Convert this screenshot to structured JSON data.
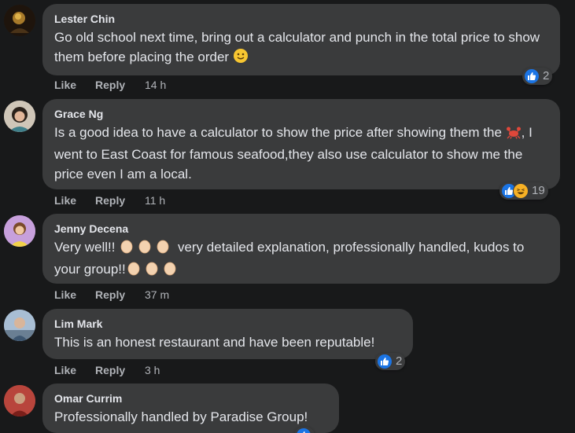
{
  "comments": [
    {
      "author": "Lester Chin",
      "text": "Go old school next time, bring out a calculator and punch in the total price to show them before placing the order",
      "emoji": "slightly-smiling-face",
      "like_label": "Like",
      "reply_label": "Reply",
      "time": "14 h",
      "reaction_count": "2",
      "reactions": [
        "like"
      ]
    },
    {
      "author": "Grace Ng",
      "text_part1": "Is a good idea to have a calculator to show the price after showing them the",
      "emoji": "crab",
      "text_part2": ", I went to East Coast for famous seafood,they also use calculator to show me the price even I am a local.",
      "like_label": "Like",
      "reply_label": "Reply",
      "time": "11 h",
      "reaction_count": "19",
      "reactions": [
        "like",
        "haha"
      ]
    },
    {
      "author": "Jenny Decena",
      "text_part1": "Very well!!",
      "text_part2": " very detailed explanation, professionally handled, kudos to your group!!",
      "emoji": "clapping-hands",
      "like_label": "Like",
      "reply_label": "Reply",
      "time": "37 m",
      "reactions": []
    },
    {
      "author": "Lim Mark",
      "text": "This is an honest restaurant and have been reputable!",
      "like_label": "Like",
      "reply_label": "Reply",
      "time": "3 h",
      "reaction_count": "2",
      "reactions": [
        "like"
      ]
    },
    {
      "author": "Omar Currim",
      "text": "Professionally handled by Paradise Group!",
      "reactions": [
        "like"
      ]
    }
  ],
  "colors": {
    "background": "#18191a",
    "bubble": "#3a3b3c",
    "text": "#e4e6eb",
    "secondary_text": "#b0b3b8",
    "like_blue": "#1b74e4",
    "haha_yellow": "#f7b125"
  }
}
